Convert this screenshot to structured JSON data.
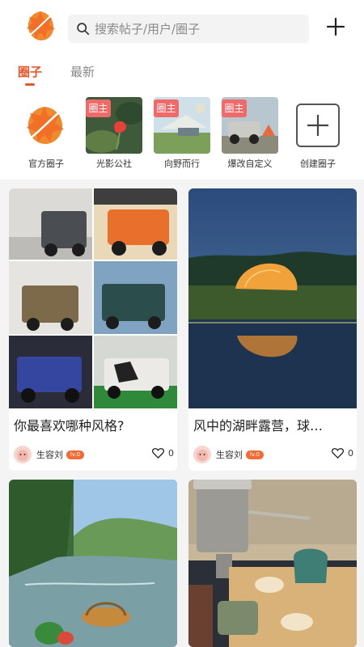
{
  "search": {
    "placeholder": "搜索帖子/用户/圈子"
  },
  "tabs": [
    {
      "label": "圈子",
      "active": true
    },
    {
      "label": "最新",
      "active": false
    }
  ],
  "circles": [
    {
      "label": "官方圈子",
      "badge": ""
    },
    {
      "label": "光影公社",
      "badge": "圈主"
    },
    {
      "label": "向野而行",
      "badge": "圈主"
    },
    {
      "label": "爆改自定义",
      "badge": "圈主"
    },
    {
      "label": "创建圈子",
      "badge": ""
    }
  ],
  "posts": [
    {
      "title": "你最喜欢哪种风格?",
      "author": "生容刘",
      "level": "lv.0",
      "likes": "0"
    },
    {
      "title": "风中的湖畔露营，球…",
      "author": "生容刘",
      "level": "lv.0",
      "likes": "0"
    },
    {
      "title": "",
      "author": "",
      "level": "",
      "likes": ""
    },
    {
      "title": "",
      "author": "",
      "level": "",
      "likes": ""
    }
  ],
  "colors": {
    "accent": "#e8562a",
    "badge": "#f06a6a",
    "feed_bg": "#f4f4f4"
  },
  "icons": {
    "logo": "autumn-leaf-logo",
    "search": "search-icon",
    "add": "plus-icon",
    "like": "heart-icon"
  }
}
